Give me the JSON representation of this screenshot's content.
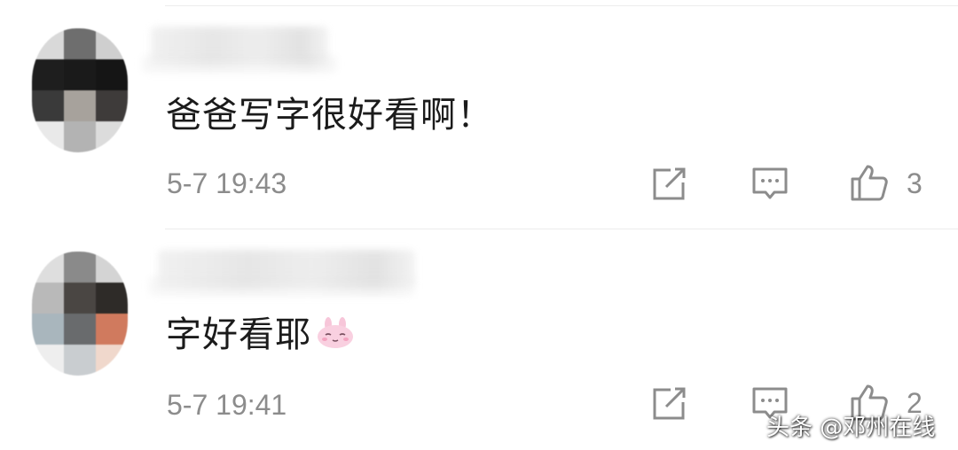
{
  "comments": [
    {
      "text": "爸爸写字很好看啊！",
      "time": "5-7 19:43",
      "likes": "3"
    },
    {
      "text": "字好看耶",
      "emoji": "bunny-emoji",
      "time": "5-7 19:41",
      "likes": "2"
    }
  ],
  "icons": {
    "share": "share-edit-icon",
    "reply": "reply-comment-icon",
    "like": "thumbs-up-icon"
  },
  "watermark": "头条 @邓州在线",
  "colors": {
    "text": "#1b1b1b",
    "meta": "#8c8c8c",
    "divider": "#ececec"
  }
}
